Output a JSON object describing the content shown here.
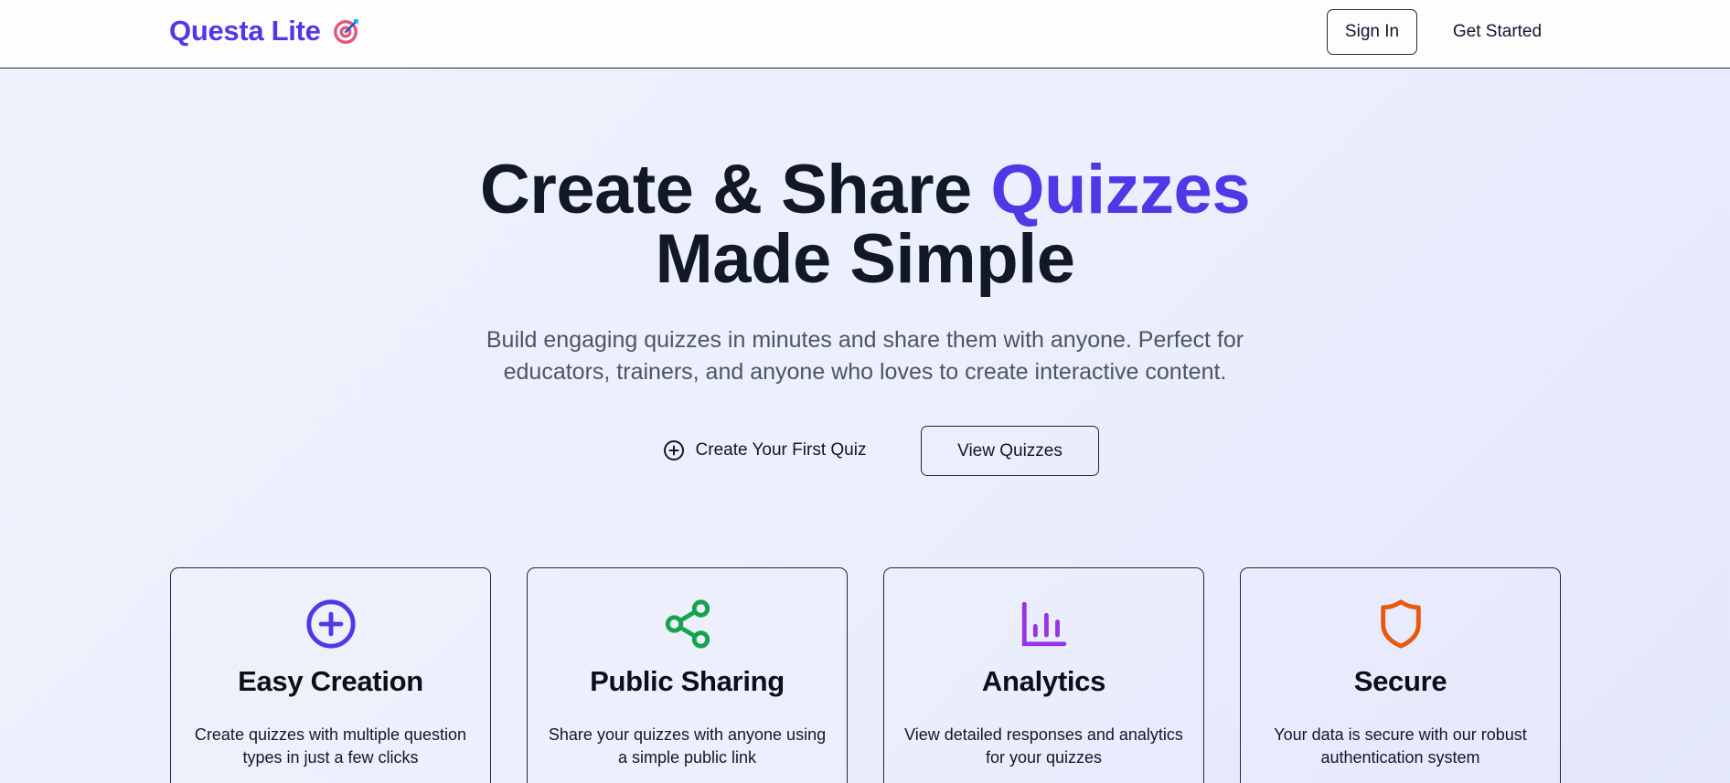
{
  "nav": {
    "brand": "Questa Lite",
    "brand_icon": "target-dart-icon",
    "signin_label": "Sign In",
    "getstarted_label": "Get Started"
  },
  "hero": {
    "title_part1": "Create & Share ",
    "title_accent": "Quizzes",
    "title_part2": "Made Simple",
    "subtitle": "Build engaging quizzes in minutes and share them with anyone. Perfect for educators, trainers, and anyone who loves to create interactive content.",
    "cta_primary_label": "Create Your First Quiz",
    "cta_primary_icon": "plus-circle-icon",
    "cta_secondary_label": "View Quizzes"
  },
  "features": [
    {
      "icon": "plus-circle-icon",
      "color": "#4f39e6",
      "title": "Easy Creation",
      "description": "Create quizzes with multiple question types in just a few clicks"
    },
    {
      "icon": "share-icon",
      "color": "#16a34a",
      "title": "Public Sharing",
      "description": "Share your quizzes with anyone using a simple public link"
    },
    {
      "icon": "bar-chart-icon",
      "color": "#9333ea",
      "title": "Analytics",
      "description": "View detailed responses and analytics for your quizzes"
    },
    {
      "icon": "shield-icon",
      "color": "#ea580c",
      "title": "Secure",
      "description": "Your data is secure with our robust authentication system"
    }
  ],
  "colors": {
    "accent": "#4f39e6",
    "text": "#111827",
    "muted": "#4b5563"
  }
}
